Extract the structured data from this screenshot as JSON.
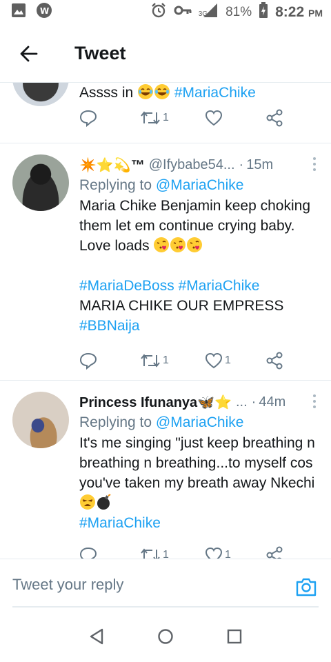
{
  "status_bar": {
    "signal_label": "3G",
    "battery_percent": "81%",
    "time": "8:22",
    "time_suffix": "PM"
  },
  "header": {
    "title": "Tweet"
  },
  "tweets": [
    {
      "text_prefix": "Assss in",
      "emojis": [
        "face-with-tears-of-joy",
        "face-with-tears-of-joy"
      ],
      "hashtag": "#MariaChike",
      "retweets": "1",
      "likes": ""
    },
    {
      "display_name": "✴️⭐💫™",
      "handle": "@Ifybabe54...",
      "dot": "·",
      "time": "15m",
      "replying_label": "Replying to",
      "replying_to": "@MariaChike",
      "text": "Maria Chike Benjamin keep choking them let em continue crying baby. Love loads",
      "emojis": [
        "face-blowing-a-kiss",
        "face-blowing-a-kiss",
        "face-blowing-a-kiss"
      ],
      "hashtags_line": [
        "#MariaDeBoss",
        "#MariaChike"
      ],
      "text2": "MARIA CHIKE OUR EMPRESS",
      "hashtag_end": "#BBNaija",
      "retweets": "1",
      "likes": "1"
    },
    {
      "display_name": "Princess Ifunanya🦋⭐",
      "handle": "...",
      "dot": "·",
      "time": "44m",
      "replying_label": "Replying to",
      "replying_to": "@MariaChike",
      "text": "It's me singing \"just keep breathing n breathing n breathing...to myself cos you've taken my breath away Nkechi",
      "emojis": [
        "weary-face",
        "bomb"
      ],
      "hashtag": "#MariaChike",
      "retweets": "1",
      "likes": "1"
    }
  ],
  "reply_bar": {
    "placeholder": "Tweet your reply"
  },
  "icons": {
    "accent": "#1da1f2",
    "muted": "#657786"
  }
}
